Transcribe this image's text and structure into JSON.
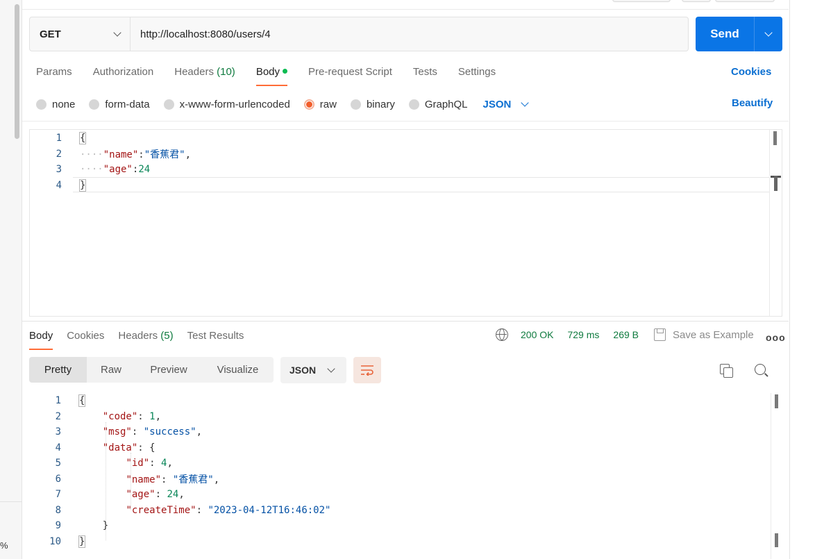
{
  "sidebar": {
    "zoom_text": "%"
  },
  "request": {
    "method": "GET",
    "url": "http://localhost:8080/users/4",
    "send_label": "Send"
  },
  "req_tabs": [
    {
      "label": "Params"
    },
    {
      "label": "Authorization"
    },
    {
      "label": "Headers",
      "count": "(10)"
    },
    {
      "label": "Body",
      "active": true
    },
    {
      "label": "Pre-request Script"
    },
    {
      "label": "Tests"
    },
    {
      "label": "Settings"
    }
  ],
  "cookies_label": "Cookies",
  "body_types": {
    "options": [
      "none",
      "form-data",
      "x-www-form-urlencoded",
      "raw",
      "binary",
      "GraphQL"
    ],
    "selected": "raw",
    "format": "JSON",
    "beautify_label": "Beautify"
  },
  "request_body": {
    "line_numbers": [
      "1",
      "2",
      "3",
      "4"
    ],
    "open": "{",
    "close": "}",
    "name_key": "\"name\"",
    "name_val": "\"香蕉君\"",
    "age_key": "\"age\"",
    "age_val": "24"
  },
  "response": {
    "tabs": [
      {
        "label": "Body",
        "active": true
      },
      {
        "label": "Cookies"
      },
      {
        "label": "Headers",
        "count": "(5)"
      },
      {
        "label": "Test Results"
      }
    ],
    "status": "200 OK",
    "time": "729 ms",
    "size": "269 B",
    "save_label": "Save as Example",
    "more_label": "ooo",
    "views": [
      "Pretty",
      "Raw",
      "Preview",
      "Visualize"
    ],
    "format": "JSON",
    "line_numbers": [
      "1",
      "2",
      "3",
      "4",
      "5",
      "6",
      "7",
      "8",
      "9",
      "10"
    ],
    "body": {
      "open": "{",
      "close": "}",
      "data_close": "}",
      "code_key": "\"code\"",
      "code_val": "1",
      "msg_key": "\"msg\"",
      "msg_val": "\"success\"",
      "data_key": "\"data\"",
      "data_open": "{",
      "id_key": "\"id\"",
      "id_val": "4",
      "name_key": "\"name\"",
      "name_val": "\"香蕉君\"",
      "age_key": "\"age\"",
      "age_val": "24",
      "ct_key": "\"createTime\"",
      "ct_val": "\"2023-04-12T16:46:02\""
    }
  },
  "colors": {
    "send_button": "#0a75e6",
    "accent_tab": "#ff6c37",
    "link_blue": "#0b6fd1",
    "status_green": "#0e7a3e"
  }
}
